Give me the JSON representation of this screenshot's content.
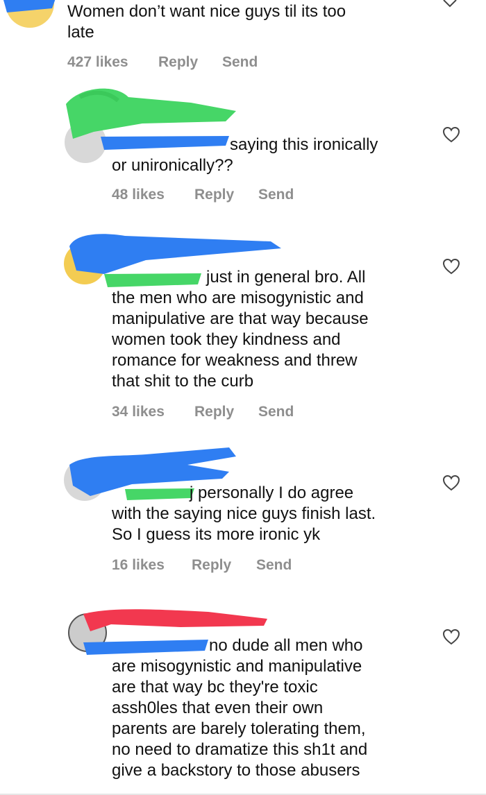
{
  "comments": [
    {
      "text": "Women don’t want nice guys til its too\nlate",
      "likes": "427 likes",
      "reply": "Reply",
      "send": "Send"
    },
    {
      "text": "saying this ironically\nor unironically??",
      "likes": "48 likes",
      "reply": "Reply",
      "send": "Send"
    },
    {
      "text": "just in general bro. All\nthe men who are misogynistic and\nmanipulative are that way because\nwomen took they kindness and\nromance for weakness and threw\nthat shit to the curb",
      "likes": "34 likes",
      "reply": "Reply",
      "send": "Send"
    },
    {
      "text": "j personally I do agree\nwith the saying nice guys finish last.\nSo I guess its more ironic yk",
      "likes": "16 likes",
      "reply": "Reply",
      "send": "Send"
    },
    {
      "text": "no dude all men who\nare misogynistic and manipulative\nare that way bc they're toxic\nassh0les that even their own\nparents are barely tolerating them,\nno need to dramatize this sh1t and\ngive a backstory to those abusers"
    }
  ],
  "icons": {
    "like": "heart-icon",
    "more": "chevron-down-icon"
  },
  "colors": {
    "redaction_blue": "#2f7ef2",
    "redaction_green": "#46d667",
    "redaction_red": "#f2384f",
    "meta_gray": "#8e8e8e"
  }
}
